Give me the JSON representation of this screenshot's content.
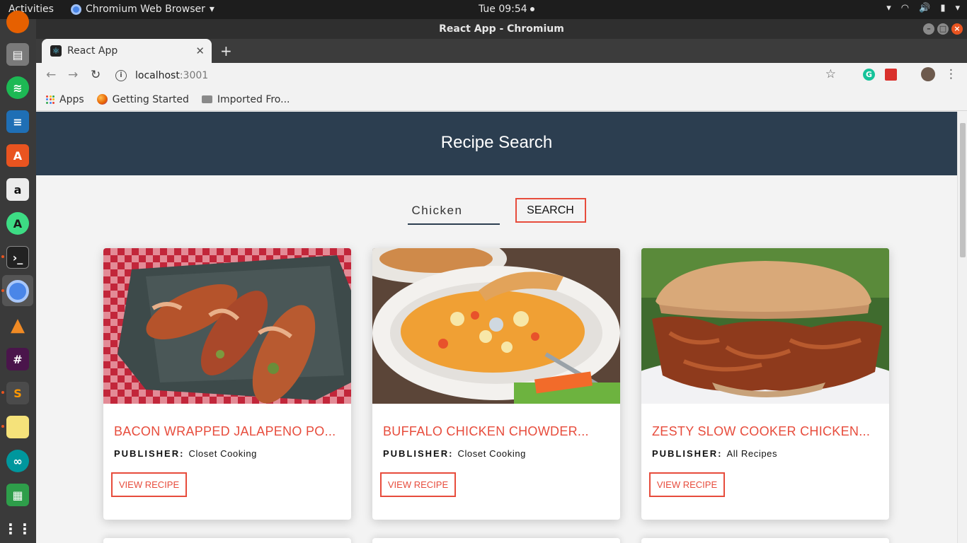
{
  "system": {
    "activities": "Activities",
    "app_name": "Chromium Web Browser",
    "clock": "Tue 09:54"
  },
  "window": {
    "title": "React App - Chromium"
  },
  "tab": {
    "label": "React App"
  },
  "address": {
    "host": "localhost",
    "port": ":3001"
  },
  "bookmarks": {
    "apps": "Apps",
    "getting_started": "Getting Started",
    "imported": "Imported Fro..."
  },
  "page": {
    "heading": "Recipe Search",
    "search_value": "Chicken",
    "search_button": "SEARCH",
    "publisher_label": "PUBLISHER:",
    "view_button": "VIEW RECIPE",
    "recipes": [
      {
        "title": "BACON WRAPPED JALAPENO PO...",
        "publisher": "Closet Cooking"
      },
      {
        "title": "BUFFALO CHICKEN CHOWDER...",
        "publisher": "Closet Cooking"
      },
      {
        "title": "ZESTY SLOW COOKER CHICKEN...",
        "publisher": "All Recipes"
      }
    ]
  },
  "colors": {
    "hero_bg": "#2c3e50",
    "accent_red": "#e74c3c"
  }
}
